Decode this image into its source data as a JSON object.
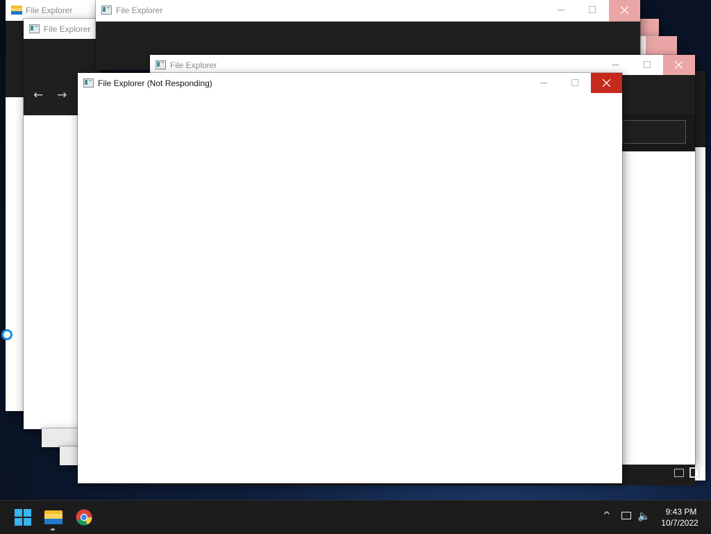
{
  "windows": [
    {
      "title": "File Explorer"
    },
    {
      "title": "File Explorer"
    },
    {
      "title": "File Explorer"
    },
    {
      "title": "File Explorer"
    },
    {
      "title": "File Explorer (Not Responding)"
    }
  ],
  "taskbar": {
    "time": "9:43 PM",
    "date": "10/7/2022"
  },
  "colors": {
    "close_active": "#c42b1c",
    "close_inactive": "#eaa6a6",
    "explorer_dark": "#1f1f1f"
  },
  "icons": [
    "start-icon",
    "file-explorer-icon",
    "chrome-icon",
    "chevron-up-icon",
    "network-icon",
    "volume-icon",
    "back-arrow-icon",
    "forward-arrow-icon",
    "close-icon",
    "minimize-icon",
    "maximize-icon"
  ]
}
